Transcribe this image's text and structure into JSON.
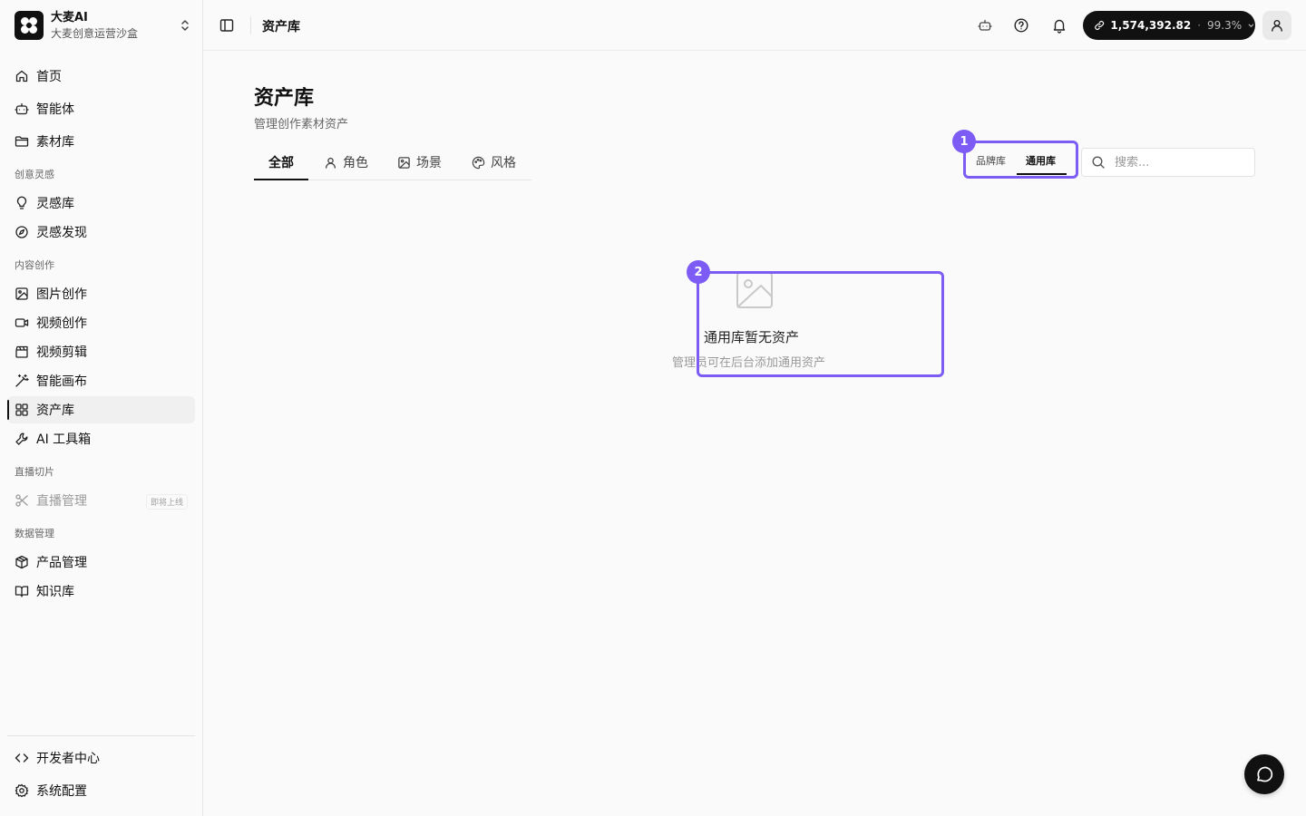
{
  "brand": {
    "name": "大麦AI",
    "subtitle": "大麦创意运营沙盒"
  },
  "sidebar": {
    "top_items": [
      {
        "label": "首页",
        "icon": "home-icon"
      },
      {
        "label": "智能体",
        "icon": "robot-icon"
      },
      {
        "label": "素材库",
        "icon": "folder-icon"
      }
    ],
    "sections": [
      {
        "label": "创意灵感",
        "items": [
          {
            "label": "灵感库",
            "icon": "lightbulb-icon"
          },
          {
            "label": "灵感发现",
            "icon": "compass-icon"
          }
        ]
      },
      {
        "label": "内容创作",
        "items": [
          {
            "label": "图片创作",
            "icon": "image-icon"
          },
          {
            "label": "视频创作",
            "icon": "video-icon"
          },
          {
            "label": "视频剪辑",
            "icon": "clapperboard-icon"
          },
          {
            "label": "智能画布",
            "icon": "magic-wand-icon"
          },
          {
            "label": "资产库",
            "icon": "grid-icon",
            "active": true
          },
          {
            "label": "AI 工具箱",
            "icon": "wrench-icon"
          }
        ]
      },
      {
        "label": "直播切片",
        "items": [
          {
            "label": "直播管理",
            "icon": "scissors-icon",
            "disabled": true,
            "badge": "即将上线"
          }
        ]
      },
      {
        "label": "数据管理",
        "items": [
          {
            "label": "产品管理",
            "icon": "package-icon"
          },
          {
            "label": "知识库",
            "icon": "book-icon"
          }
        ]
      }
    ],
    "bottom_items": [
      {
        "label": "开发者中心",
        "icon": "code-icon"
      },
      {
        "label": "系统配置",
        "icon": "settings-icon"
      }
    ]
  },
  "topbar": {
    "breadcrumb": "资产库",
    "credits": {
      "amount": "1,574,392.82",
      "separator": "·",
      "percent": "99.3%"
    }
  },
  "main": {
    "title": "资产库",
    "subtitle": "管理创作素材资产",
    "tabs": [
      {
        "label": "全部",
        "active": true
      },
      {
        "label": "角色",
        "icon": "user-icon"
      },
      {
        "label": "场景",
        "icon": "image-icon"
      },
      {
        "label": "风格",
        "icon": "palette-icon"
      }
    ],
    "library_toggle": [
      {
        "label": "品牌库"
      },
      {
        "label": "通用库",
        "active": true
      }
    ],
    "search": {
      "placeholder": "搜索..."
    },
    "empty_state": {
      "title": "通用库暂无资产",
      "description": "管理员可在后台添加通用资产"
    }
  },
  "annotations": [
    {
      "label": "1"
    },
    {
      "label": "2"
    }
  ],
  "colors": {
    "accent": "#7c5cf5",
    "primary": "#111111",
    "background": "#fafafa"
  }
}
